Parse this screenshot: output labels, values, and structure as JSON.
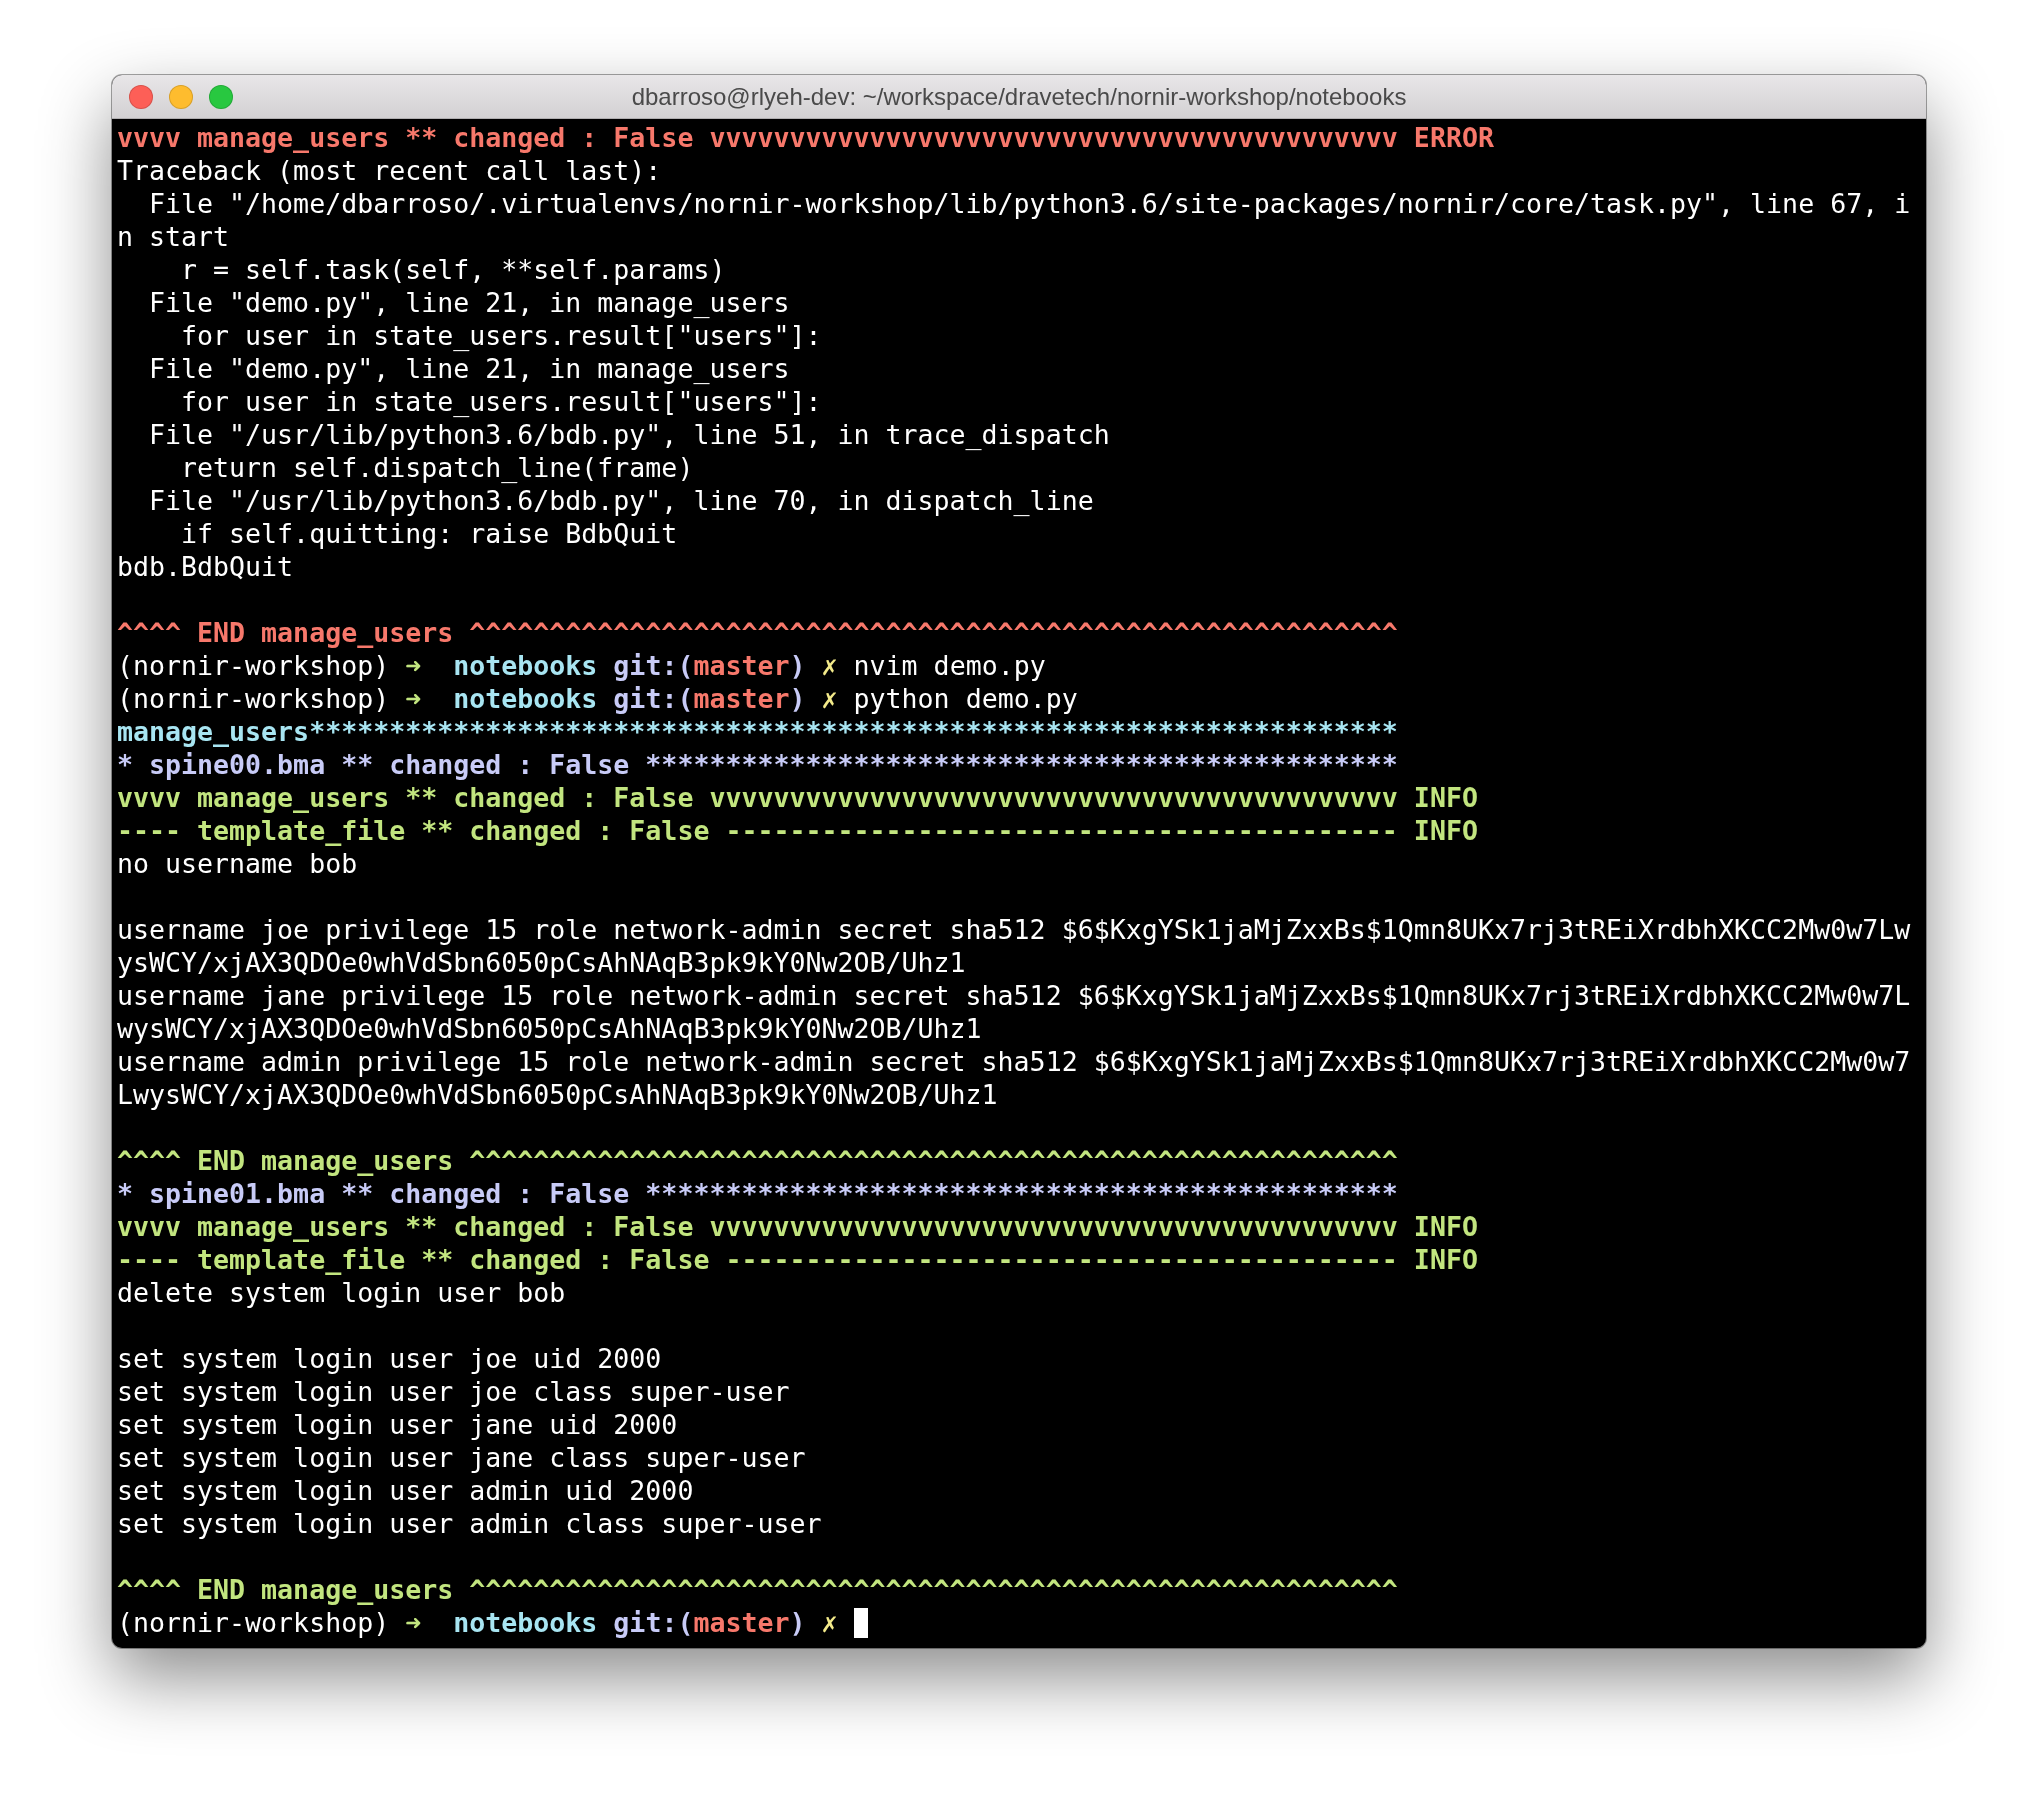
{
  "window": {
    "title": "dbarroso@rlyeh-dev: ~/workspace/dravetech/nornir-workshop/notebooks"
  },
  "lines": [
    {
      "kind": "text",
      "segments": [
        {
          "kind": "error",
          "text": "vvvv manage_users ** changed : False vvvvvvvvvvvvvvvvvvvvvvvvvvvvvvvvvvvvvvvvvvv ERROR"
        }
      ]
    },
    {
      "kind": "text",
      "segments": [
        {
          "kind": "plain",
          "text": "Traceback (most recent call last):"
        }
      ]
    },
    {
      "kind": "text",
      "segments": [
        {
          "kind": "plain",
          "text": "  File \"/home/dbarroso/.virtualenvs/nornir-workshop/lib/python3.6/site-packages/nornir/core/task.py\", line 67, i"
        }
      ]
    },
    {
      "kind": "text",
      "segments": [
        {
          "kind": "plain",
          "text": "n start"
        }
      ]
    },
    {
      "kind": "text",
      "segments": [
        {
          "kind": "plain",
          "text": "    r = self.task(self, **self.params)"
        }
      ]
    },
    {
      "kind": "text",
      "segments": [
        {
          "kind": "plain",
          "text": "  File \"demo.py\", line 21, in manage_users"
        }
      ]
    },
    {
      "kind": "text",
      "segments": [
        {
          "kind": "plain",
          "text": "    for user in state_users.result[\"users\"]:"
        }
      ]
    },
    {
      "kind": "text",
      "segments": [
        {
          "kind": "plain",
          "text": "  File \"demo.py\", line 21, in manage_users"
        }
      ]
    },
    {
      "kind": "text",
      "segments": [
        {
          "kind": "plain",
          "text": "    for user in state_users.result[\"users\"]:"
        }
      ]
    },
    {
      "kind": "text",
      "segments": [
        {
          "kind": "plain",
          "text": "  File \"/usr/lib/python3.6/bdb.py\", line 51, in trace_dispatch"
        }
      ]
    },
    {
      "kind": "text",
      "segments": [
        {
          "kind": "plain",
          "text": "    return self.dispatch_line(frame)"
        }
      ]
    },
    {
      "kind": "text",
      "segments": [
        {
          "kind": "plain",
          "text": "  File \"/usr/lib/python3.6/bdb.py\", line 70, in dispatch_line"
        }
      ]
    },
    {
      "kind": "text",
      "segments": [
        {
          "kind": "plain",
          "text": "    if self.quitting: raise BdbQuit"
        }
      ]
    },
    {
      "kind": "text",
      "segments": [
        {
          "kind": "plain",
          "text": "bdb.BdbQuit"
        }
      ]
    },
    {
      "kind": "blank"
    },
    {
      "kind": "text",
      "segments": [
        {
          "kind": "error",
          "text": "^^^^ END manage_users ^^^^^^^^^^^^^^^^^^^^^^^^^^^^^^^^^^^^^^^^^^^^^^^^^^^^^^^^^^"
        }
      ]
    },
    {
      "kind": "text",
      "segments": [
        {
          "kind": "plain",
          "text": "(nornir-workshop) "
        },
        {
          "kind": "arrow",
          "text": "➜  "
        },
        {
          "kind": "dir",
          "text": "notebooks "
        },
        {
          "kind": "git",
          "text": "git:("
        },
        {
          "kind": "branch",
          "text": "master"
        },
        {
          "kind": "git",
          "text": ")"
        },
        {
          "kind": "dirty",
          "text": " ✗ "
        },
        {
          "kind": "plain",
          "text": "nvim demo.py"
        }
      ]
    },
    {
      "kind": "text",
      "segments": [
        {
          "kind": "plain",
          "text": "(nornir-workshop) "
        },
        {
          "kind": "arrow",
          "text": "➜  "
        },
        {
          "kind": "dir",
          "text": "notebooks "
        },
        {
          "kind": "git",
          "text": "git:("
        },
        {
          "kind": "branch",
          "text": "master"
        },
        {
          "kind": "git",
          "text": ")"
        },
        {
          "kind": "dirty",
          "text": " ✗ "
        },
        {
          "kind": "plain",
          "text": "python demo.py"
        }
      ]
    },
    {
      "kind": "text",
      "segments": [
        {
          "kind": "dir",
          "text": "manage_users********************************************************************"
        }
      ]
    },
    {
      "kind": "text",
      "segments": [
        {
          "kind": "host",
          "text": "* spine00.bma ** changed : False ***********************************************"
        }
      ]
    },
    {
      "kind": "text",
      "segments": [
        {
          "kind": "info",
          "text": "vvvv manage_users ** changed : False vvvvvvvvvvvvvvvvvvvvvvvvvvvvvvvvvvvvvvvvvvv INFO"
        }
      ]
    },
    {
      "kind": "text",
      "segments": [
        {
          "kind": "info",
          "text": "---- template_file ** changed : False ------------------------------------------ INFO"
        }
      ]
    },
    {
      "kind": "text",
      "segments": [
        {
          "kind": "plain",
          "text": "no username bob"
        }
      ]
    },
    {
      "kind": "blank"
    },
    {
      "kind": "text",
      "segments": [
        {
          "kind": "plain",
          "text": "username joe privilege 15 role network-admin secret sha512 $6$KxgYSk1jaMjZxxBs$1Qmn8UKx7rj3tREiXrdbhXKCC2Mw0w7Lw"
        }
      ]
    },
    {
      "kind": "text",
      "segments": [
        {
          "kind": "plain",
          "text": "ysWCY/xjAX3QDOe0whVdSbn6050pCsAhNAqB3pk9kY0Nw2OB/Uhz1"
        }
      ]
    },
    {
      "kind": "text",
      "segments": [
        {
          "kind": "plain",
          "text": "username jane privilege 15 role network-admin secret sha512 $6$KxgYSk1jaMjZxxBs$1Qmn8UKx7rj3tREiXrdbhXKCC2Mw0w7L"
        }
      ]
    },
    {
      "kind": "text",
      "segments": [
        {
          "kind": "plain",
          "text": "wysWCY/xjAX3QDOe0whVdSbn6050pCsAhNAqB3pk9kY0Nw2OB/Uhz1"
        }
      ]
    },
    {
      "kind": "text",
      "segments": [
        {
          "kind": "plain",
          "text": "username admin privilege 15 role network-admin secret sha512 $6$KxgYSk1jaMjZxxBs$1Qmn8UKx7rj3tREiXrdbhXKCC2Mw0w7"
        }
      ]
    },
    {
      "kind": "text",
      "segments": [
        {
          "kind": "plain",
          "text": "LwysWCY/xjAX3QDOe0whVdSbn6050pCsAhNAqB3pk9kY0Nw2OB/Uhz1"
        }
      ]
    },
    {
      "kind": "blank"
    },
    {
      "kind": "text",
      "segments": [
        {
          "kind": "info",
          "text": "^^^^ END manage_users ^^^^^^^^^^^^^^^^^^^^^^^^^^^^^^^^^^^^^^^^^^^^^^^^^^^^^^^^^^"
        }
      ]
    },
    {
      "kind": "text",
      "segments": [
        {
          "kind": "host",
          "text": "* spine01.bma ** changed : False ***********************************************"
        }
      ]
    },
    {
      "kind": "text",
      "segments": [
        {
          "kind": "info",
          "text": "vvvv manage_users ** changed : False vvvvvvvvvvvvvvvvvvvvvvvvvvvvvvvvvvvvvvvvvvv INFO"
        }
      ]
    },
    {
      "kind": "text",
      "segments": [
        {
          "kind": "info",
          "text": "---- template_file ** changed : False ------------------------------------------ INFO"
        }
      ]
    },
    {
      "kind": "text",
      "segments": [
        {
          "kind": "plain",
          "text": "delete system login user bob"
        }
      ]
    },
    {
      "kind": "blank"
    },
    {
      "kind": "text",
      "segments": [
        {
          "kind": "plain",
          "text": "set system login user joe uid 2000"
        }
      ]
    },
    {
      "kind": "text",
      "segments": [
        {
          "kind": "plain",
          "text": "set system login user joe class super-user"
        }
      ]
    },
    {
      "kind": "text",
      "segments": [
        {
          "kind": "plain",
          "text": "set system login user jane uid 2000"
        }
      ]
    },
    {
      "kind": "text",
      "segments": [
        {
          "kind": "plain",
          "text": "set system login user jane class super-user"
        }
      ]
    },
    {
      "kind": "text",
      "segments": [
        {
          "kind": "plain",
          "text": "set system login user admin uid 2000"
        }
      ]
    },
    {
      "kind": "text",
      "segments": [
        {
          "kind": "plain",
          "text": "set system login user admin class super-user"
        }
      ]
    },
    {
      "kind": "blank"
    },
    {
      "kind": "text",
      "segments": [
        {
          "kind": "info",
          "text": "^^^^ END manage_users ^^^^^^^^^^^^^^^^^^^^^^^^^^^^^^^^^^^^^^^^^^^^^^^^^^^^^^^^^^"
        }
      ]
    },
    {
      "kind": "prompt",
      "segments": [
        {
          "kind": "plain",
          "text": "(nornir-workshop) "
        },
        {
          "kind": "arrow",
          "text": "➜  "
        },
        {
          "kind": "dir",
          "text": "notebooks "
        },
        {
          "kind": "git",
          "text": "git:("
        },
        {
          "kind": "branch",
          "text": "master"
        },
        {
          "kind": "git",
          "text": ")"
        },
        {
          "kind": "dirty",
          "text": " ✗ "
        }
      ]
    }
  ]
}
